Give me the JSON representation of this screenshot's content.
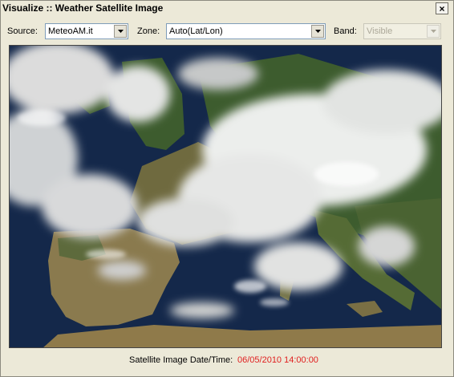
{
  "window": {
    "title": "Visualize :: Weather Satellite Image",
    "close_glyph": "×"
  },
  "toolbar": {
    "source_label": "Source:",
    "source_value": "MeteoAM.it",
    "zone_label": "Zone:",
    "zone_value": "Auto(Lat/Lon)",
    "band_label": "Band:",
    "band_value": "Visible",
    "band_enabled": false
  },
  "image": {
    "icon": "satellite-image",
    "colors": {
      "sea": "#14284a",
      "land": "#8a7a4e",
      "vegetation": "#3d5c2e",
      "cloud": "#e8eae8"
    }
  },
  "footer": {
    "datetime_label": "Satellite Image Date/Time:",
    "datetime_value": "06/05/2010 14:00:00",
    "datetime_color": "#e02020"
  }
}
